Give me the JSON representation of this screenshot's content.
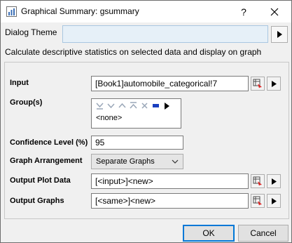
{
  "window": {
    "title": "Graphical Summary: gsummary",
    "help_label": "?"
  },
  "theme": {
    "label": "Dialog Theme",
    "value": ""
  },
  "description": "Calculate descriptive statistics on selected data and display on graph",
  "form": {
    "input": {
      "label": "Input",
      "value": "[Book1]automobile_categorical!7"
    },
    "groups": {
      "label": "Group(s)",
      "items": [
        "<none>"
      ]
    },
    "confidence": {
      "label": "Confidence Level (%)",
      "value": "95"
    },
    "arrangement": {
      "label": "Graph Arrangement",
      "selected": "Separate Graphs"
    },
    "output_plot": {
      "label": "Output Plot Data",
      "value": "[<input>]<new>"
    },
    "output_graphs": {
      "label": "Output Graphs",
      "value": "[<same>]<new>"
    }
  },
  "buttons": {
    "ok": "OK",
    "cancel": "Cancel"
  },
  "colors": {
    "accent": "#0078d7",
    "theme_field": "#e6f0f8",
    "dialog_bg": "#f0f0f0"
  }
}
